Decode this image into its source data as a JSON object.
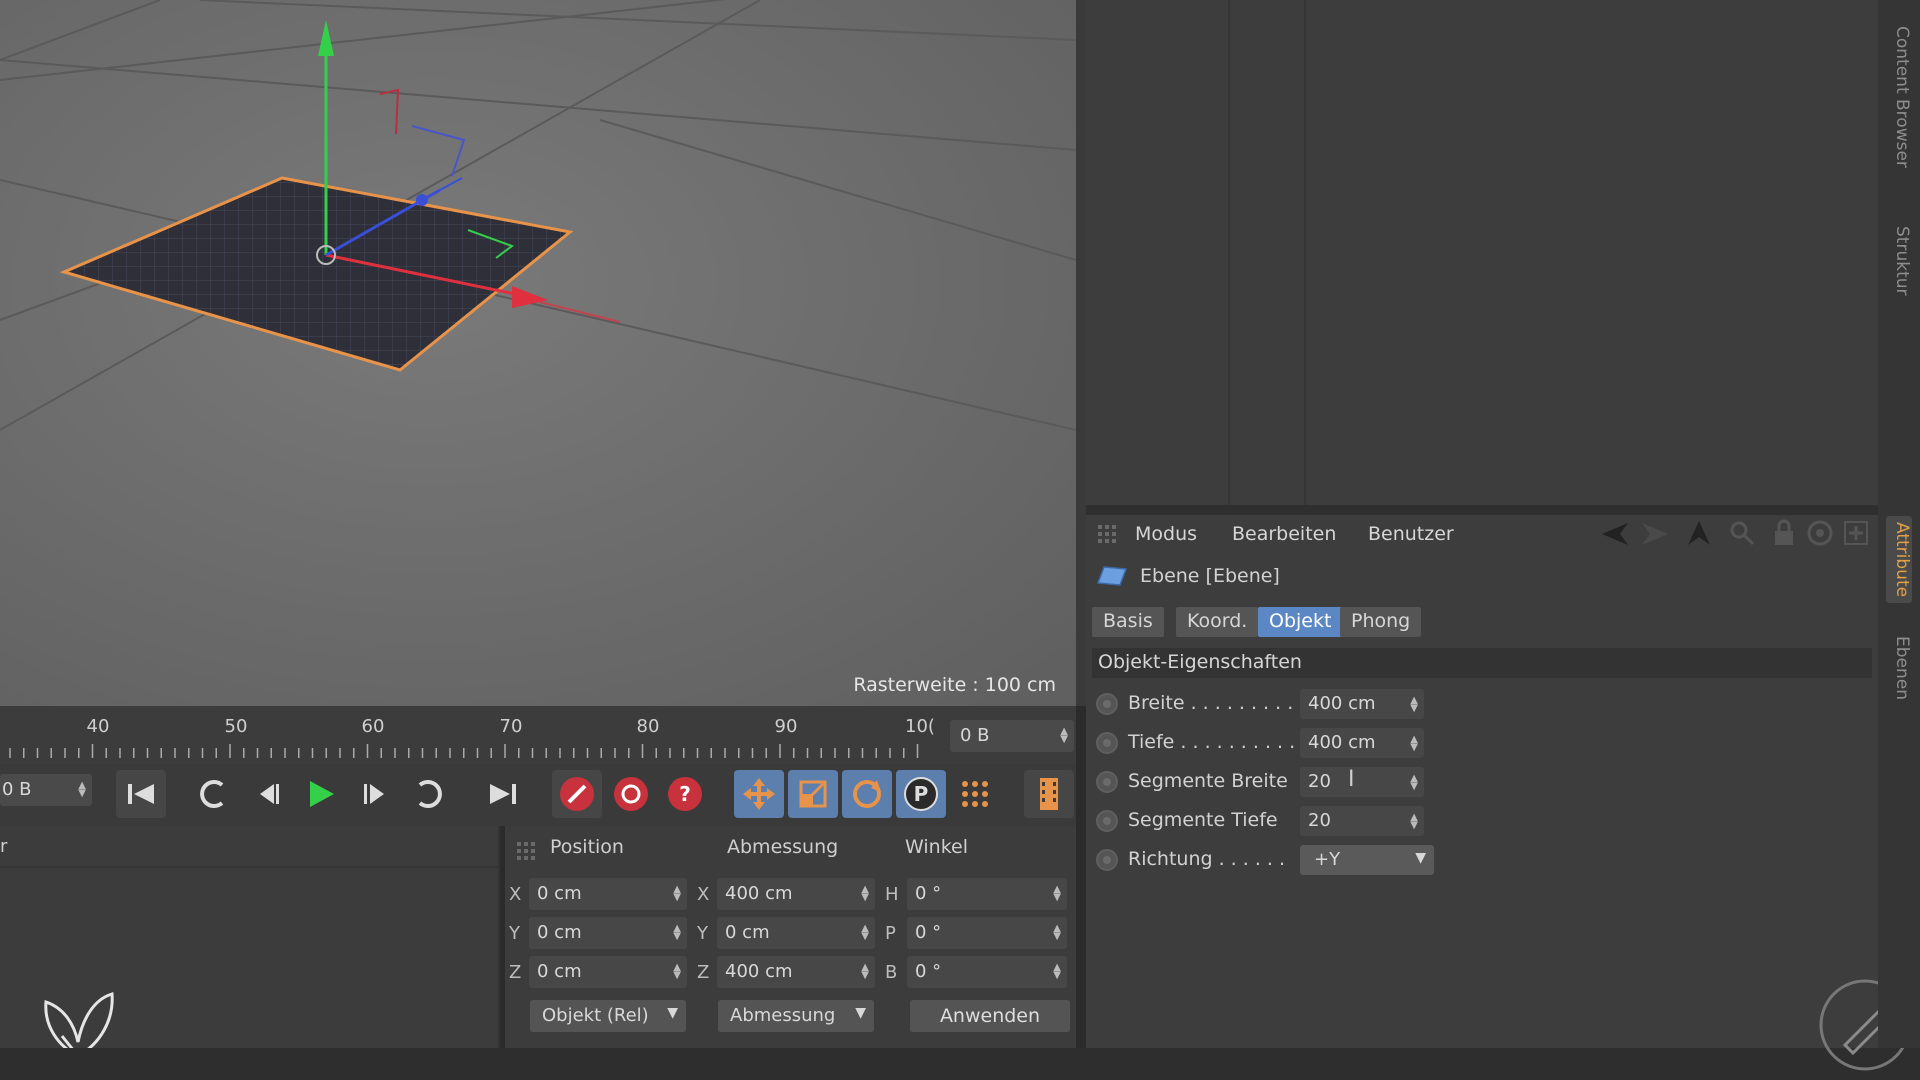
{
  "viewport": {
    "raster_label": "Rasterweite : 100 cm"
  },
  "timeline": {
    "ticks": [
      "40",
      "50",
      "60",
      "70",
      "80",
      "90",
      "10("
    ],
    "frame_end": "0 B",
    "frame_current": "0 B"
  },
  "left_panel": {
    "header_fragment": "r"
  },
  "coordinates": {
    "headers": {
      "position": "Position",
      "size": "Abmessung",
      "rotation": "Winkel"
    },
    "rows": [
      {
        "axis_pos": "X",
        "pos": "0 cm",
        "axis_size": "X",
        "size": "400 cm",
        "axis_rot": "H",
        "rot": "0 °"
      },
      {
        "axis_pos": "Y",
        "pos": "0 cm",
        "axis_size": "Y",
        "size": "0 cm",
        "axis_rot": "P",
        "rot": "0 °"
      },
      {
        "axis_pos": "Z",
        "pos": "0 cm",
        "axis_size": "Z",
        "size": "400 cm",
        "axis_rot": "B",
        "rot": "0 °"
      }
    ],
    "mode_dropdown": "Objekt (Rel)",
    "size_dropdown": "Abmessung",
    "apply_label": "Anwenden"
  },
  "attributes": {
    "menu": {
      "mode": "Modus",
      "edit": "Bearbeiten",
      "user": "Benutzer"
    },
    "object_title": "Ebene [Ebene]",
    "tabs": [
      {
        "label": "Basis",
        "active": false
      },
      {
        "label": "Koord.",
        "active": false
      },
      {
        "label": "Objekt",
        "active": true
      },
      {
        "label": "Phong",
        "active": false
      }
    ],
    "section_title": "Objekt-Eigenschaften",
    "properties": [
      {
        "label": "Breite . . . . . . . . . .",
        "value": "400 cm"
      },
      {
        "label": "Tiefe . . . . . . . . . . .",
        "value": "400 cm"
      },
      {
        "label": "Segmente Breite",
        "value": "20"
      },
      {
        "label": "Segmente Tiefe",
        "value": "20"
      },
      {
        "label": "Richtung . . . . . .",
        "value": "+Y"
      }
    ]
  },
  "side_tabs": {
    "content_browser": "Content Browser",
    "structure": "Struktur",
    "attributes": "Attribute",
    "layers": "Ebenen"
  },
  "colors": {
    "accent_blue": "#5b87c5",
    "selection_orange": "#e8934a",
    "axis_x": "#e03040",
    "axis_y": "#35d04a",
    "axis_z": "#3a4fd8"
  }
}
